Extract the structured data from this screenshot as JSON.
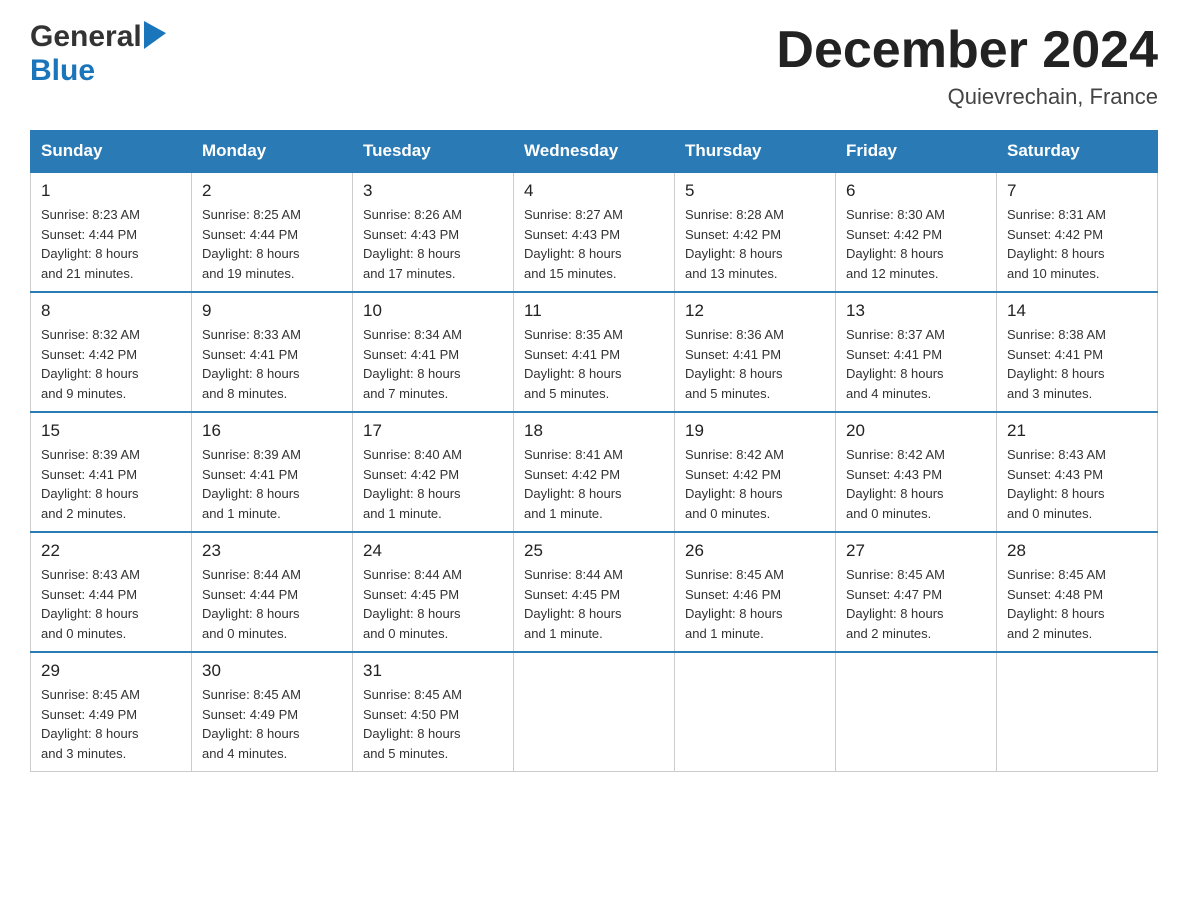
{
  "header": {
    "logo_general": "General",
    "logo_blue": "Blue",
    "title": "December 2024",
    "location": "Quievrechain, France"
  },
  "days_of_week": [
    "Sunday",
    "Monday",
    "Tuesday",
    "Wednesday",
    "Thursday",
    "Friday",
    "Saturday"
  ],
  "weeks": [
    [
      {
        "day": "1",
        "sunrise": "8:23 AM",
        "sunset": "4:44 PM",
        "daylight": "8 hours and 21 minutes."
      },
      {
        "day": "2",
        "sunrise": "8:25 AM",
        "sunset": "4:44 PM",
        "daylight": "8 hours and 19 minutes."
      },
      {
        "day": "3",
        "sunrise": "8:26 AM",
        "sunset": "4:43 PM",
        "daylight": "8 hours and 17 minutes."
      },
      {
        "day": "4",
        "sunrise": "8:27 AM",
        "sunset": "4:43 PM",
        "daylight": "8 hours and 15 minutes."
      },
      {
        "day": "5",
        "sunrise": "8:28 AM",
        "sunset": "4:42 PM",
        "daylight": "8 hours and 13 minutes."
      },
      {
        "day": "6",
        "sunrise": "8:30 AM",
        "sunset": "4:42 PM",
        "daylight": "8 hours and 12 minutes."
      },
      {
        "day": "7",
        "sunrise": "8:31 AM",
        "sunset": "4:42 PM",
        "daylight": "8 hours and 10 minutes."
      }
    ],
    [
      {
        "day": "8",
        "sunrise": "8:32 AM",
        "sunset": "4:42 PM",
        "daylight": "8 hours and 9 minutes."
      },
      {
        "day": "9",
        "sunrise": "8:33 AM",
        "sunset": "4:41 PM",
        "daylight": "8 hours and 8 minutes."
      },
      {
        "day": "10",
        "sunrise": "8:34 AM",
        "sunset": "4:41 PM",
        "daylight": "8 hours and 7 minutes."
      },
      {
        "day": "11",
        "sunrise": "8:35 AM",
        "sunset": "4:41 PM",
        "daylight": "8 hours and 5 minutes."
      },
      {
        "day": "12",
        "sunrise": "8:36 AM",
        "sunset": "4:41 PM",
        "daylight": "8 hours and 5 minutes."
      },
      {
        "day": "13",
        "sunrise": "8:37 AM",
        "sunset": "4:41 PM",
        "daylight": "8 hours and 4 minutes."
      },
      {
        "day": "14",
        "sunrise": "8:38 AM",
        "sunset": "4:41 PM",
        "daylight": "8 hours and 3 minutes."
      }
    ],
    [
      {
        "day": "15",
        "sunrise": "8:39 AM",
        "sunset": "4:41 PM",
        "daylight": "8 hours and 2 minutes."
      },
      {
        "day": "16",
        "sunrise": "8:39 AM",
        "sunset": "4:41 PM",
        "daylight": "8 hours and 1 minute."
      },
      {
        "day": "17",
        "sunrise": "8:40 AM",
        "sunset": "4:42 PM",
        "daylight": "8 hours and 1 minute."
      },
      {
        "day": "18",
        "sunrise": "8:41 AM",
        "sunset": "4:42 PM",
        "daylight": "8 hours and 1 minute."
      },
      {
        "day": "19",
        "sunrise": "8:42 AM",
        "sunset": "4:42 PM",
        "daylight": "8 hours and 0 minutes."
      },
      {
        "day": "20",
        "sunrise": "8:42 AM",
        "sunset": "4:43 PM",
        "daylight": "8 hours and 0 minutes."
      },
      {
        "day": "21",
        "sunrise": "8:43 AM",
        "sunset": "4:43 PM",
        "daylight": "8 hours and 0 minutes."
      }
    ],
    [
      {
        "day": "22",
        "sunrise": "8:43 AM",
        "sunset": "4:44 PM",
        "daylight": "8 hours and 0 minutes."
      },
      {
        "day": "23",
        "sunrise": "8:44 AM",
        "sunset": "4:44 PM",
        "daylight": "8 hours and 0 minutes."
      },
      {
        "day": "24",
        "sunrise": "8:44 AM",
        "sunset": "4:45 PM",
        "daylight": "8 hours and 0 minutes."
      },
      {
        "day": "25",
        "sunrise": "8:44 AM",
        "sunset": "4:45 PM",
        "daylight": "8 hours and 1 minute."
      },
      {
        "day": "26",
        "sunrise": "8:45 AM",
        "sunset": "4:46 PM",
        "daylight": "8 hours and 1 minute."
      },
      {
        "day": "27",
        "sunrise": "8:45 AM",
        "sunset": "4:47 PM",
        "daylight": "8 hours and 2 minutes."
      },
      {
        "day": "28",
        "sunrise": "8:45 AM",
        "sunset": "4:48 PM",
        "daylight": "8 hours and 2 minutes."
      }
    ],
    [
      {
        "day": "29",
        "sunrise": "8:45 AM",
        "sunset": "4:49 PM",
        "daylight": "8 hours and 3 minutes."
      },
      {
        "day": "30",
        "sunrise": "8:45 AM",
        "sunset": "4:49 PM",
        "daylight": "8 hours and 4 minutes."
      },
      {
        "day": "31",
        "sunrise": "8:45 AM",
        "sunset": "4:50 PM",
        "daylight": "8 hours and 5 minutes."
      },
      null,
      null,
      null,
      null
    ]
  ],
  "labels": {
    "sunrise": "Sunrise:",
    "sunset": "Sunset:",
    "daylight": "Daylight:"
  }
}
